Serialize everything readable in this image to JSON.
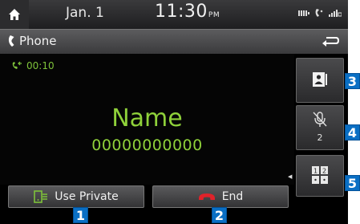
{
  "status_bar": {
    "date": "Jan.  1",
    "time": "11:30",
    "ampm": "PM",
    "icons": [
      "home-icon",
      "battery-icon",
      "bluetooth-phone-icon",
      "signal-icon"
    ]
  },
  "title_bar": {
    "title": "Phone",
    "icon": "phone-handset-icon",
    "back_icon": "back-arrow-icon"
  },
  "call": {
    "duration": "00:10",
    "caller_name": "Name",
    "caller_number": "00000000000"
  },
  "side_buttons": {
    "contacts_icon": "contacts-icon",
    "mic_mute_icon": "mic-mute-icon",
    "mic_level": "2",
    "keypad_icon": "keypad-icon",
    "keypad_digits": [
      "1",
      "2"
    ]
  },
  "bottom_buttons": {
    "use_private": "Use Private",
    "end": "End"
  },
  "callouts": [
    "1",
    "2",
    "3",
    "4",
    "5"
  ],
  "colors": {
    "accent_green": "#8fd13a",
    "end_red": "#e0222a",
    "callout_blue": "#0a6fc4"
  }
}
